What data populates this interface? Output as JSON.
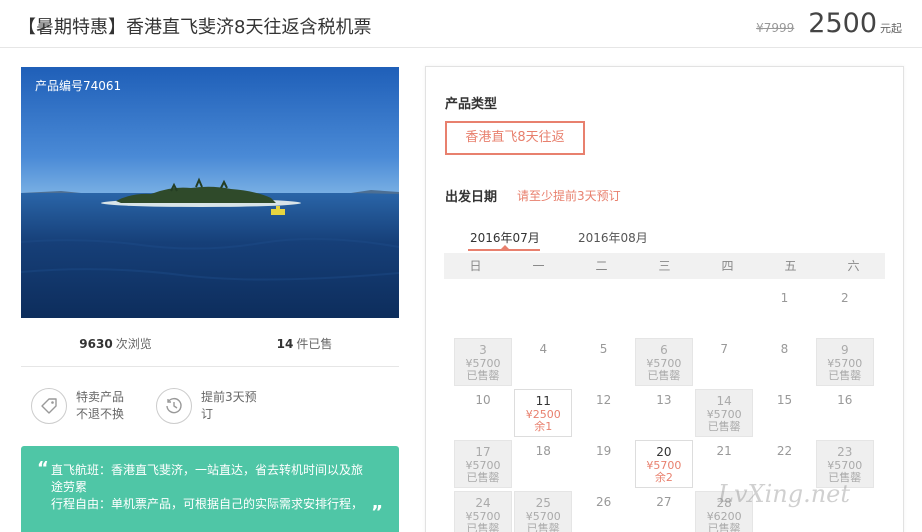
{
  "header": {
    "title": "【暑期特惠】香港直飞斐济8天往返含税机票",
    "price_old": "¥7999",
    "price_now": "2500",
    "price_unit": "元起"
  },
  "photo": {
    "product_no": "产品编号74061"
  },
  "stats": {
    "views_num": "9630",
    "views_label": "次浏览",
    "sold_num": "14",
    "sold_label": "件已售"
  },
  "features": [
    {
      "icon": "tag-icon",
      "line1": "特卖产品",
      "line2": "不退不换"
    },
    {
      "icon": "clock-icon",
      "line1": "提前3天预",
      "line2": "订"
    }
  ],
  "note": {
    "line1": "直飞航班：香港直飞斐济，一站直达，省去转机时间以及旅",
    "line2": "途劳累",
    "line3": "行程自由：单机票产品，可根据自己的实际需求安排行程，"
  },
  "panel": {
    "type_label": "产品类型",
    "type_option": "香港直飞8天往返",
    "date_label": "出发日期",
    "date_hint": "请至少提前3天预订",
    "months": [
      "2016年07月",
      "2016年08月"
    ],
    "weekdays": [
      "日",
      "一",
      "二",
      "三",
      "四",
      "五",
      "六"
    ]
  },
  "calendar": [
    {
      "day": "1",
      "col": 5,
      "row": 0,
      "state": "plain"
    },
    {
      "day": "2",
      "col": 6,
      "row": 0,
      "state": "plain"
    },
    {
      "day": "3",
      "col": 0,
      "row": 1,
      "state": "soldout",
      "price": "¥5700",
      "status": "已售罄"
    },
    {
      "day": "4",
      "col": 1,
      "row": 1,
      "state": "plain"
    },
    {
      "day": "5",
      "col": 2,
      "row": 1,
      "state": "plain"
    },
    {
      "day": "6",
      "col": 3,
      "row": 1,
      "state": "soldout",
      "price": "¥5700",
      "status": "已售罄"
    },
    {
      "day": "7",
      "col": 4,
      "row": 1,
      "state": "plain"
    },
    {
      "day": "8",
      "col": 5,
      "row": 1,
      "state": "plain"
    },
    {
      "day": "9",
      "col": 6,
      "row": 1,
      "state": "soldout",
      "price": "¥5700",
      "status": "已售罄"
    },
    {
      "day": "10",
      "col": 0,
      "row": 2,
      "state": "plain"
    },
    {
      "day": "11",
      "col": 1,
      "row": 2,
      "state": "avail",
      "price": "¥2500",
      "status": "余1"
    },
    {
      "day": "12",
      "col": 2,
      "row": 2,
      "state": "plain"
    },
    {
      "day": "13",
      "col": 3,
      "row": 2,
      "state": "plain"
    },
    {
      "day": "14",
      "col": 4,
      "row": 2,
      "state": "soldout",
      "price": "¥5700",
      "status": "已售罄"
    },
    {
      "day": "15",
      "col": 5,
      "row": 2,
      "state": "plain"
    },
    {
      "day": "16",
      "col": 6,
      "row": 2,
      "state": "plain"
    },
    {
      "day": "17",
      "col": 0,
      "row": 3,
      "state": "soldout",
      "price": "¥5700",
      "status": "已售罄"
    },
    {
      "day": "18",
      "col": 1,
      "row": 3,
      "state": "plain"
    },
    {
      "day": "19",
      "col": 2,
      "row": 3,
      "state": "plain"
    },
    {
      "day": "20",
      "col": 3,
      "row": 3,
      "state": "avail",
      "price": "¥5700",
      "status": "余2"
    },
    {
      "day": "21",
      "col": 4,
      "row": 3,
      "state": "plain"
    },
    {
      "day": "22",
      "col": 5,
      "row": 3,
      "state": "plain"
    },
    {
      "day": "23",
      "col": 6,
      "row": 3,
      "state": "soldout",
      "price": "¥5700",
      "status": "已售罄"
    },
    {
      "day": "24",
      "col": 0,
      "row": 4,
      "state": "soldout",
      "price": "¥5700",
      "status": "已售罄"
    },
    {
      "day": "25",
      "col": 1,
      "row": 4,
      "state": "soldout",
      "price": "¥5700",
      "status": "已售罄"
    },
    {
      "day": "26",
      "col": 2,
      "row": 4,
      "state": "plain"
    },
    {
      "day": "27",
      "col": 3,
      "row": 4,
      "state": "plain"
    },
    {
      "day": "28",
      "col": 4,
      "row": 4,
      "state": "soldout",
      "price": "¥6200",
      "status": "已售罄"
    }
  ],
  "watermark": "LvXing.net",
  "colors": {
    "accent": "#e8806e",
    "note_bg": "#4fc6a6",
    "sky": "#2a6fc9",
    "sea": "#123f78"
  }
}
